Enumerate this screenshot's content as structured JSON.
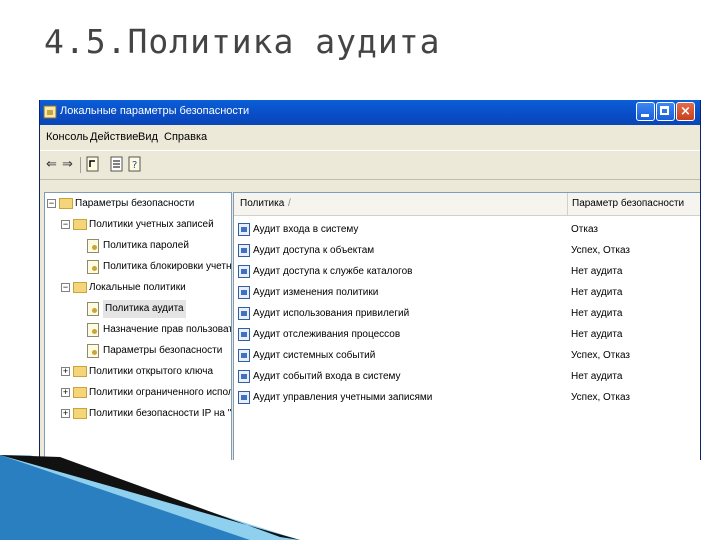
{
  "slide": {
    "title": "4.5.Политика аудита"
  },
  "window": {
    "title": "Локальные параметры безопасности",
    "buttons": {
      "close_glyph": "×"
    }
  },
  "menu": [
    "Консоль",
    "Действие",
    "Вид",
    "Справка"
  ],
  "toolbar": {
    "back_glyph": "⇐",
    "forward_glyph": "⇒"
  },
  "tree": [
    {
      "label": "Параметры безопасности",
      "level": 0,
      "expander": "−",
      "icon": "security-settings-icon"
    },
    {
      "label": "Политики учетных записей",
      "level": 1,
      "expander": "−",
      "icon": "folder-icon"
    },
    {
      "label": "Политика паролей",
      "level": 2,
      "expander": "",
      "icon": "policy-icon"
    },
    {
      "label": "Политика блокировки учетной записи",
      "level": 2,
      "expander": "",
      "icon": "policy-icon"
    },
    {
      "label": "Локальные политики",
      "level": 1,
      "expander": "−",
      "icon": "folder-icon"
    },
    {
      "label": "Политика аудита",
      "level": 2,
      "expander": "",
      "icon": "policy-icon",
      "selected": true
    },
    {
      "label": "Назначение прав пользователя",
      "level": 2,
      "expander": "",
      "icon": "policy-icon"
    },
    {
      "label": "Параметры безопасности",
      "level": 2,
      "expander": "",
      "icon": "policy-icon"
    },
    {
      "label": "Политики открытого ключа",
      "level": 1,
      "expander": "+",
      "icon": "folder-icon"
    },
    {
      "label": "Политики ограниченного использования п",
      "level": 1,
      "expander": "+",
      "icon": "folder-icon"
    },
    {
      "label": "Политики безопасности IP на \"Локальный",
      "level": 1,
      "expander": "+",
      "icon": "computer-icon"
    }
  ],
  "table": {
    "columns": {
      "policy": "Политика",
      "sort_glyph": "/",
      "setting": "Параметр безопасности"
    },
    "rows": [
      {
        "policy": "Аудит входа в систему",
        "setting": "Отказ"
      },
      {
        "policy": "Аудит доступа к объектам",
        "setting": "Успех, Отказ"
      },
      {
        "policy": "Аудит доступа к службе каталогов",
        "setting": "Нет аудита"
      },
      {
        "policy": "Аудит изменения политики",
        "setting": "Нет аудита"
      },
      {
        "policy": "Аудит использования привилегий",
        "setting": "Нет аудита"
      },
      {
        "policy": "Аудит отслеживания процессов",
        "setting": "Нет аудита"
      },
      {
        "policy": "Аудит системных событий",
        "setting": "Успех, Отказ"
      },
      {
        "policy": "Аудит событий входа в систему",
        "setting": "Нет аудита"
      },
      {
        "policy": "Аудит управления учетными записями",
        "setting": "Успех, Отказ"
      }
    ]
  },
  "colors": {
    "titlebar": "#0a4cc5",
    "window_bg": "#ece9d8",
    "deco_blue": "#2a7fc0",
    "deco_dark": "#111111"
  }
}
